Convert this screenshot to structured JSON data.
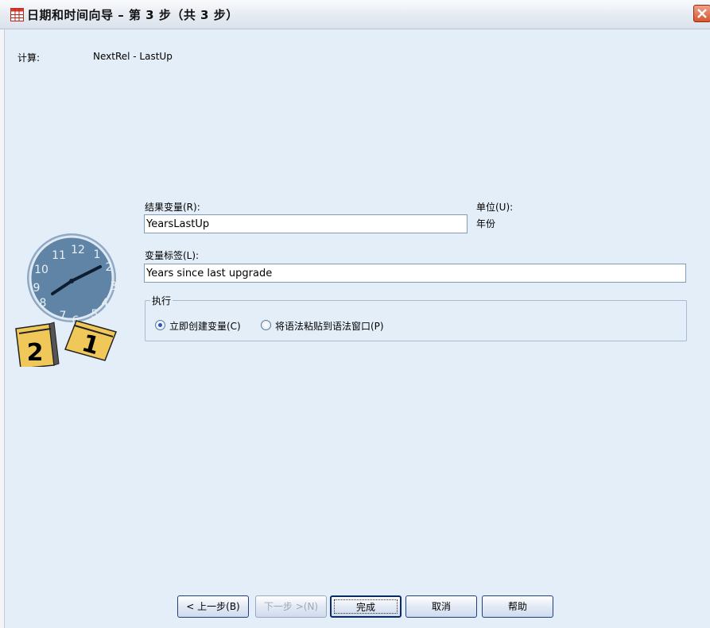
{
  "window": {
    "title": "日期和时间向导 – 第 3 步（共 3 步）"
  },
  "calculation": {
    "label": "计算:",
    "expression": "NextRel - LastUp"
  },
  "result_variable": {
    "label": "结果变量(R):",
    "value": "YearsLastUp"
  },
  "unit": {
    "label": "单位(U):",
    "value": "年份"
  },
  "variable_label": {
    "label": "变量标签(L):",
    "value": "Years since last upgrade"
  },
  "execute": {
    "group_title": "执行",
    "options": [
      {
        "label": "立即创建变量(C)",
        "selected": true
      },
      {
        "label": "将语法粘贴到语法窗口(P)",
        "selected": false
      }
    ]
  },
  "buttons": {
    "back": "< 上一步(B)",
    "next": "下一步 >(N)",
    "finish": "完成",
    "cancel": "取消",
    "help": "帮助"
  },
  "illustration": {
    "clock_numbers": [
      "12",
      "1",
      "2",
      "3",
      "4",
      "5",
      "6",
      "7",
      "8",
      "9",
      "10",
      "11"
    ],
    "calendar_pages": [
      "2",
      "1"
    ]
  },
  "colors": {
    "background": "#e4eef8",
    "clock_face": "#5f84a6",
    "calendar_yellow": "#f0c85a",
    "close_button": "#d9562f"
  }
}
